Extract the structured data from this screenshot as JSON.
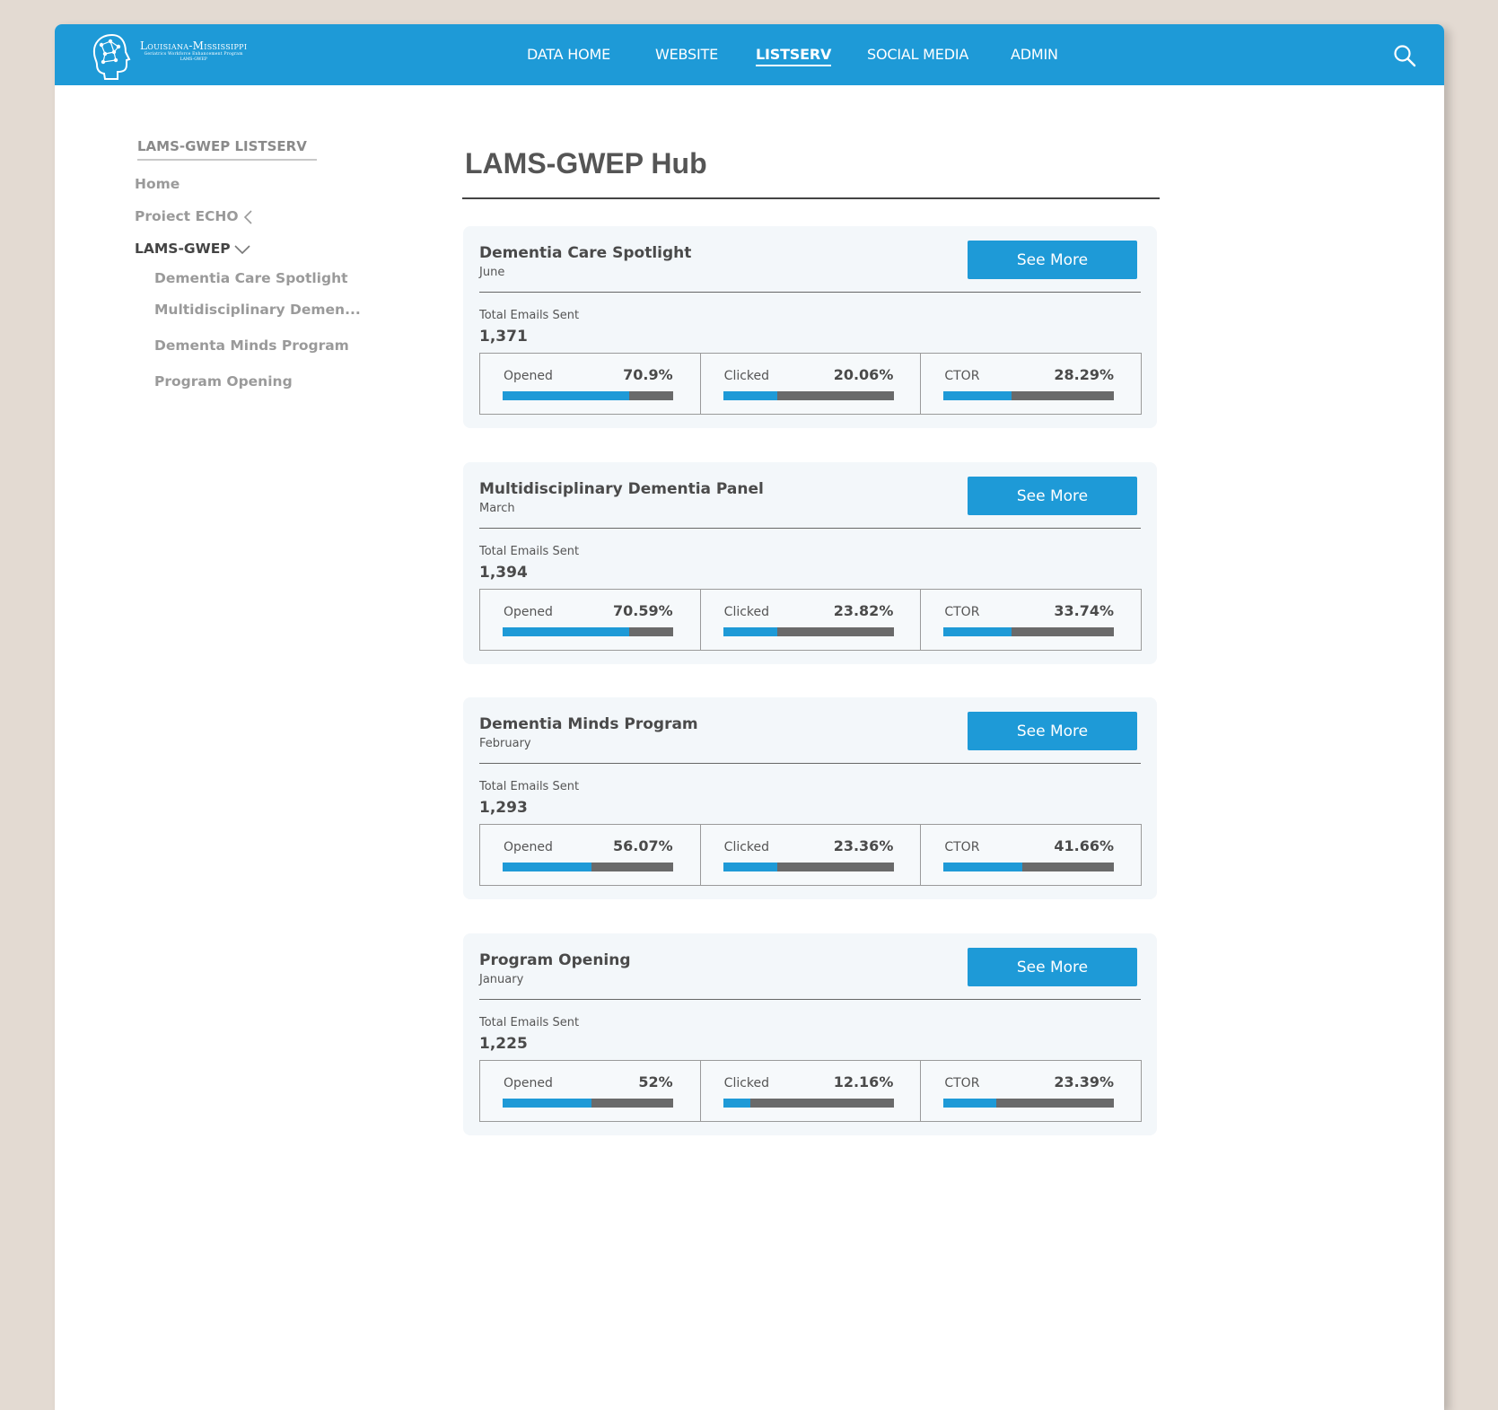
{
  "brand": {
    "name": "Louisiana-Mississippi",
    "subtitle": "Geriatrics Workforce Enhancement Program",
    "abbr": "LAMS-GWEP"
  },
  "nav": {
    "items": [
      "DATA HOME",
      "WEBSITE",
      "LISTSERV",
      "SOCIAL MEDIA",
      "ADMIN"
    ],
    "active": "LISTSERV"
  },
  "sidebar": {
    "title": "LAMS-GWEP LISTSERV",
    "links": [
      "Home",
      "Proiect ECHO",
      "LAMS-GWEP"
    ],
    "sublinks": [
      "Dementia Care Spotlight",
      "Multidisciplinary Demen...",
      "Dementa Minds Program",
      "Program Opening"
    ]
  },
  "page": {
    "title": "LAMS-GWEP Hub"
  },
  "labels": {
    "see_more": "See More",
    "total_emails": "Total Emails Sent",
    "opened": "Opened",
    "clicked": "Clicked",
    "ctor": "CTOR"
  },
  "colors": {
    "primary": "#1e9ad7",
    "bar_track": "#6a6a6a",
    "card_bg": "#f3f7fa"
  },
  "campaigns": [
    {
      "title": "Dementia Care Spotlight",
      "month": "June",
      "total": "1,371",
      "opened": "70.9%",
      "clicked": "20.06%",
      "ctor": "28.29%",
      "opened_frac": 0.74,
      "clicked_frac": 0.32,
      "ctor_frac": 0.4
    },
    {
      "title": "Multidisciplinary Dementia Panel",
      "month": "March",
      "total": "1,394",
      "opened": "70.59%",
      "clicked": "23.82%",
      "ctor": "33.74%",
      "opened_frac": 0.74,
      "clicked_frac": 0.32,
      "ctor_frac": 0.4
    },
    {
      "title": "Dementia Minds Program",
      "month": "February",
      "total": "1,293",
      "opened": "56.07%",
      "clicked": "23.36%",
      "ctor": "41.66%",
      "opened_frac": 0.52,
      "clicked_frac": 0.32,
      "ctor_frac": 0.46
    },
    {
      "title": "Program Opening",
      "month": "January",
      "total": "1,225",
      "opened": "52%",
      "clicked": "12.16%",
      "ctor": "23.39%",
      "opened_frac": 0.52,
      "clicked_frac": 0.16,
      "ctor_frac": 0.31
    }
  ]
}
